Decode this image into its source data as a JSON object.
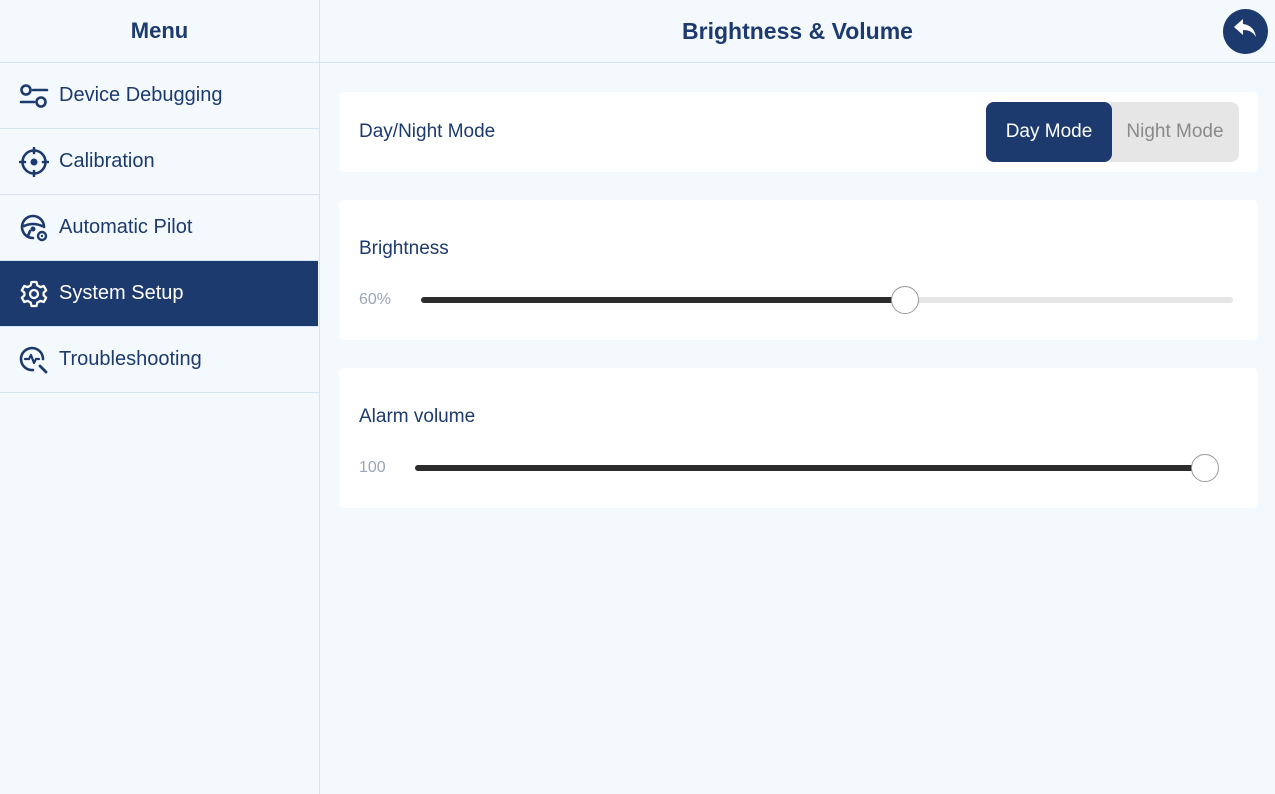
{
  "sidebar": {
    "title": "Menu",
    "items": [
      {
        "label": "Device Debugging",
        "icon": "sliders-icon"
      },
      {
        "label": "Calibration",
        "icon": "crosshair-icon"
      },
      {
        "label": "Automatic Pilot",
        "icon": "steering-wheel-icon"
      },
      {
        "label": "System Setup",
        "icon": "gear-icon",
        "active": true
      },
      {
        "label": "Troubleshooting",
        "icon": "diagnostic-search-icon"
      }
    ]
  },
  "header": {
    "title": "Brightness & Volume",
    "back_icon": "back-arrow-icon"
  },
  "mode": {
    "label": "Day/Night Mode",
    "options": [
      "Day Mode",
      "Night Mode"
    ],
    "selected": "Day Mode"
  },
  "brightness": {
    "title": "Brightness",
    "value_text": "60%",
    "value": 60,
    "max": 100
  },
  "alarm": {
    "title": "Alarm volume",
    "value_text": "100",
    "value": 100,
    "max": 100
  },
  "colors": {
    "accent": "#1c3a6e",
    "background": "#f4f9fd",
    "track": "#e6e6e6",
    "fill": "#2d2d2d"
  }
}
